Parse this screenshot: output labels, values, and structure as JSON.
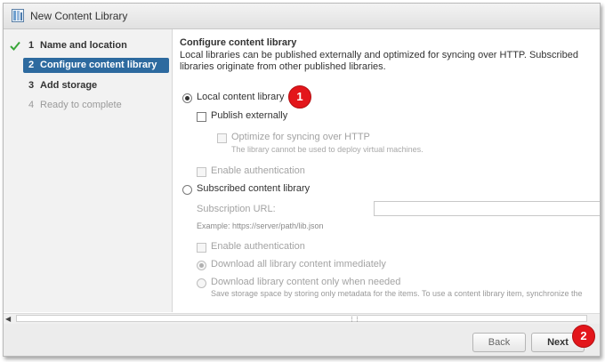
{
  "window": {
    "title": "New Content Library"
  },
  "steps": [
    {
      "number": "1",
      "label": "Name and location",
      "state": "done"
    },
    {
      "number": "2",
      "label": "Configure content library",
      "state": "active"
    },
    {
      "number": "3",
      "label": "Add storage",
      "state": "pending"
    },
    {
      "number": "4",
      "label": "Ready to complete",
      "state": "disabled"
    }
  ],
  "content": {
    "heading": "Configure content library",
    "description": "Local libraries can be published externally and optimized for syncing over HTTP. Subscribed libraries originate from other published libraries.",
    "local_option": "Local content library",
    "publish_externally": "Publish externally",
    "optimize_http": "Optimize for syncing over HTTP",
    "optimize_hint": "The library cannot be used to deploy virtual machines.",
    "enable_auth_local": "Enable authentication",
    "subscribed_option": "Subscribed content library",
    "subscription_url_label": "Subscription URL:",
    "subscription_url_value": "",
    "subscription_example": "Example: https://server/path/lib.json",
    "enable_auth_subscribed": "Enable authentication",
    "download_all": "Download all library content immediately",
    "download_when_needed": "Download library content only when needed",
    "download_when_needed_hint": "Save storage space by storing only metadata for the items. To use a content library item, synchronize the"
  },
  "annotations": {
    "badge1": "1",
    "badge2": "2"
  },
  "footer": {
    "back_label": "Back",
    "next_label": "Next"
  },
  "colors": {
    "active_step": "#2d6a9f",
    "badge": "#e3161b",
    "check": "#3aa63a"
  }
}
